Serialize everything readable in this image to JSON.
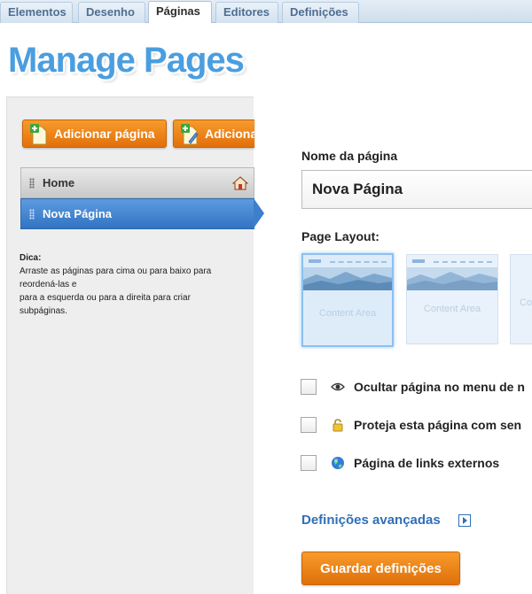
{
  "tabs": [
    {
      "label": "Elementos"
    },
    {
      "label": "Desenho"
    },
    {
      "label": "Páginas",
      "active": true
    },
    {
      "label": "Editores"
    },
    {
      "label": "Definições"
    }
  ],
  "header": {
    "title": "Manage Pages"
  },
  "sidebar": {
    "add_page_label": "Adicionar página",
    "second_button_label": "Adiciona",
    "pages": [
      {
        "label": "Home",
        "is_home": true
      },
      {
        "label": "Nova Página",
        "selected": true
      }
    ],
    "tip_title": "Dica:",
    "tip_lines": [
      "Arraste as páginas para cima ou para baixo para",
      "reordená-las e",
      "para a esquerda ou para a direita para criar",
      "subpáginas."
    ]
  },
  "form": {
    "page_name_label": "Nome da página",
    "page_name_value": "Nova Página",
    "layout_label": "Page Layout:",
    "layouts": [
      {
        "label": "Content Area",
        "selected": true
      },
      {
        "label": "Content Area"
      },
      {
        "label": "Co"
      }
    ],
    "options": [
      {
        "label": "Ocultar página no menu de n",
        "icon": "eye-icon",
        "checked": false
      },
      {
        "label": "Proteja esta página com sen",
        "icon": "lock-icon",
        "checked": false
      },
      {
        "label": "Página de links externos",
        "icon": "globe-icon",
        "checked": false
      }
    ],
    "advanced_link": "Definições avançadas",
    "save_button": "Guardar definições"
  },
  "colors": {
    "accent_orange": "#e8800f",
    "accent_blue": "#3b7dcb",
    "link_blue": "#2f6fb8"
  }
}
